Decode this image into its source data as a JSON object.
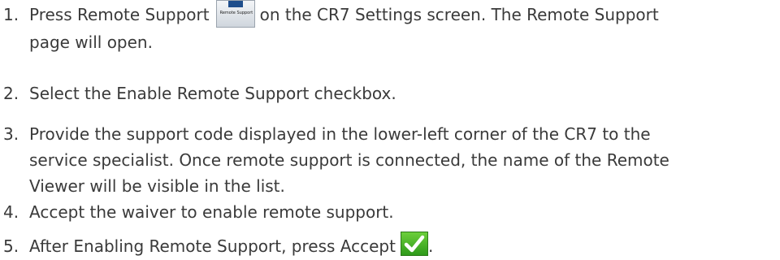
{
  "steps": [
    {
      "number": "1.",
      "text_before_icon": "Press Remote Support",
      "text_after_icon": "on the CR7 Settings screen. The Remote Support",
      "text_line2": "page will open.",
      "icon": "remote-support-icon",
      "icon_caption": "Remote Support"
    },
    {
      "number": "2.",
      "text": "Select the Enable Remote Support checkbox."
    },
    {
      "number": "3.",
      "line1": "Provide the support code displayed in the lower-left corner of the CR7 to the",
      "line2": "service specialist. Once remote support is connected, the name of the Remote",
      "line3": "Viewer will be visible in the list."
    },
    {
      "number": "4.",
      "text": "Accept the waiver to enable remote support."
    },
    {
      "number": "5.",
      "text": "After Enabling Remote Support, press Accept",
      "trailing": ".",
      "icon": "accept-check-icon"
    }
  ],
  "colors": {
    "text": "#3a3a3a",
    "accept_green": "#3aa91f",
    "remote_support_blue": "#1f4e8c"
  }
}
